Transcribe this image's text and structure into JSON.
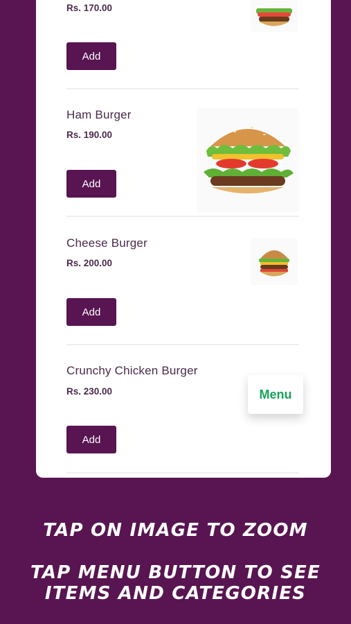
{
  "menu_items": [
    {
      "name": "",
      "price": "Rs. 170.00",
      "add_label": "Add"
    },
    {
      "name": "Ham Burger",
      "price": "Rs. 190.00",
      "add_label": "Add"
    },
    {
      "name": "Cheese Burger",
      "price": "Rs. 200.00",
      "add_label": "Add"
    },
    {
      "name": "Crunchy Chicken Burger",
      "price": "Rs. 230.00",
      "add_label": "Add"
    }
  ],
  "menu_button": {
    "label": "Menu"
  },
  "hints": {
    "line1": "Tap on image to zoom",
    "line2": "Tap menu button to see",
    "line3": "items and categories"
  },
  "colors": {
    "background": "#581551",
    "button": "#581551",
    "menu_text": "#1aa35a"
  },
  "icons": [
    "burger-image",
    "ham-burger-image",
    "cheese-burger-image"
  ]
}
